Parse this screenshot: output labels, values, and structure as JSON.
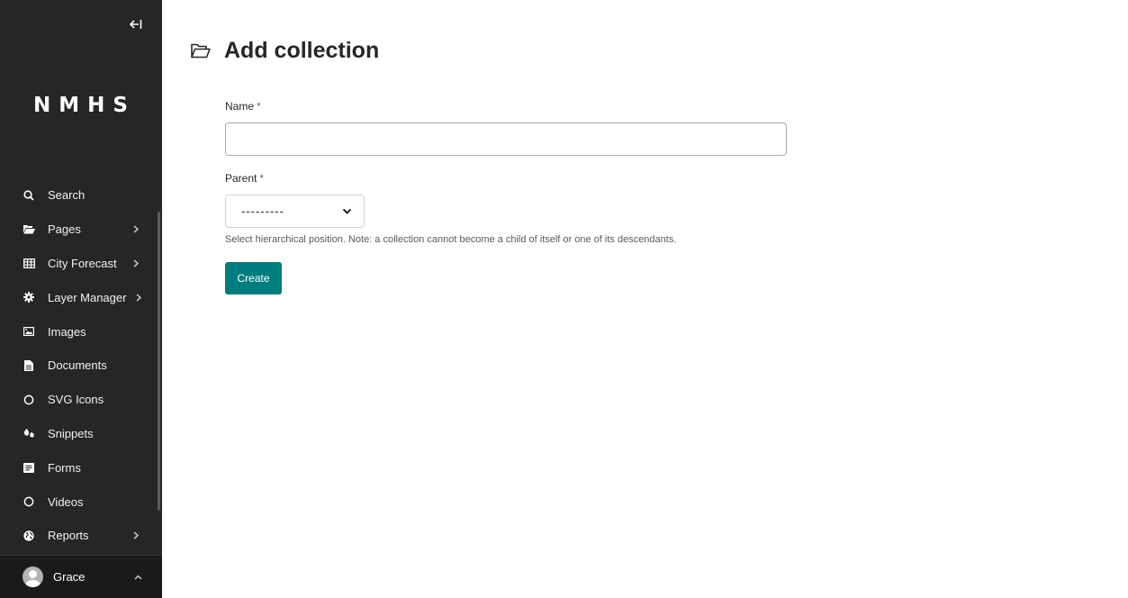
{
  "sidebar": {
    "logo": "NMHS",
    "items": [
      {
        "label": "Search",
        "icon": "search-icon",
        "has_submenu": false
      },
      {
        "label": "Pages",
        "icon": "folder-open-icon",
        "has_submenu": true
      },
      {
        "label": "City Forecast",
        "icon": "table-icon",
        "has_submenu": true
      },
      {
        "label": "Layer Manager",
        "icon": "gear-icon",
        "has_submenu": true
      },
      {
        "label": "Images",
        "icon": "image-icon",
        "has_submenu": false
      },
      {
        "label": "Documents",
        "icon": "document-icon",
        "has_submenu": false
      },
      {
        "label": "SVG Icons",
        "icon": "circle-icon",
        "has_submenu": false
      },
      {
        "label": "Snippets",
        "icon": "snippet-icon",
        "has_submenu": false
      },
      {
        "label": "Forms",
        "icon": "form-icon",
        "has_submenu": false
      },
      {
        "label": "Videos",
        "icon": "circle-icon",
        "has_submenu": false
      },
      {
        "label": "Reports",
        "icon": "globe-icon",
        "has_submenu": true
      }
    ],
    "account": {
      "name": "Grace"
    }
  },
  "page": {
    "title": "Add collection",
    "icon": "folder-open-icon"
  },
  "form": {
    "name_label": "Name",
    "name_required": "*",
    "name_value": "",
    "parent_label": "Parent",
    "parent_required": "*",
    "parent_selected": "---------",
    "parent_help": "Select hierarchical position. Note: a collection cannot become a child of itself or one of its descendants.",
    "submit_label": "Create"
  },
  "colors": {
    "sidebar_bg": "#262626",
    "primary_button": "#007d7e"
  }
}
